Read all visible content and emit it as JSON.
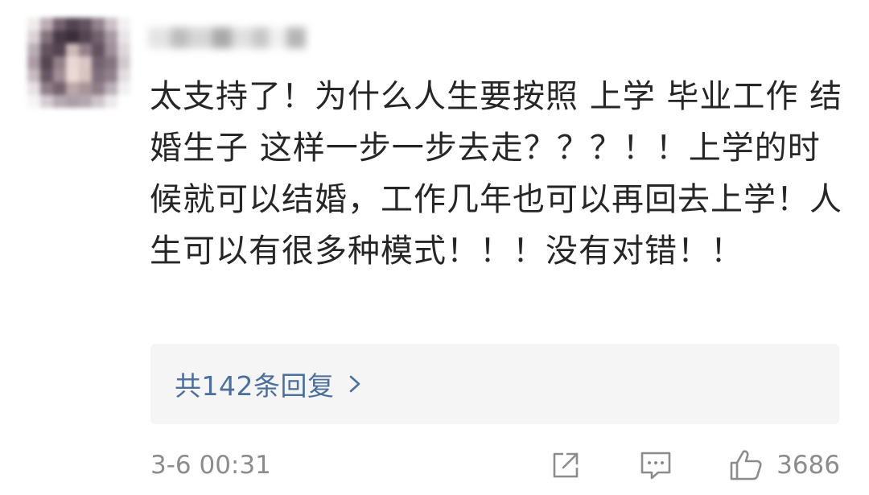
{
  "comment": {
    "text": "太支持了！为什么人生要按照 上学 毕业工作 结婚生子 这样一步一步去走？？？！！上学的时候就可以结婚，工作几年也可以再回去上学！人生可以有很多种模式！！！没有对错！！"
  },
  "replies": {
    "label": "共142条回复"
  },
  "footer": {
    "timestamp": "3-6 00:31",
    "like_count": "3686"
  },
  "icons": {
    "share": "share-icon",
    "comment": "comment-icon",
    "like": "thumbs-up-icon",
    "chevron": "chevron-right-icon"
  },
  "colors": {
    "text": "#262626",
    "link": "#4c6f9c",
    "muted": "#8c8c8c",
    "reply_bg": "#f5f5f5"
  }
}
